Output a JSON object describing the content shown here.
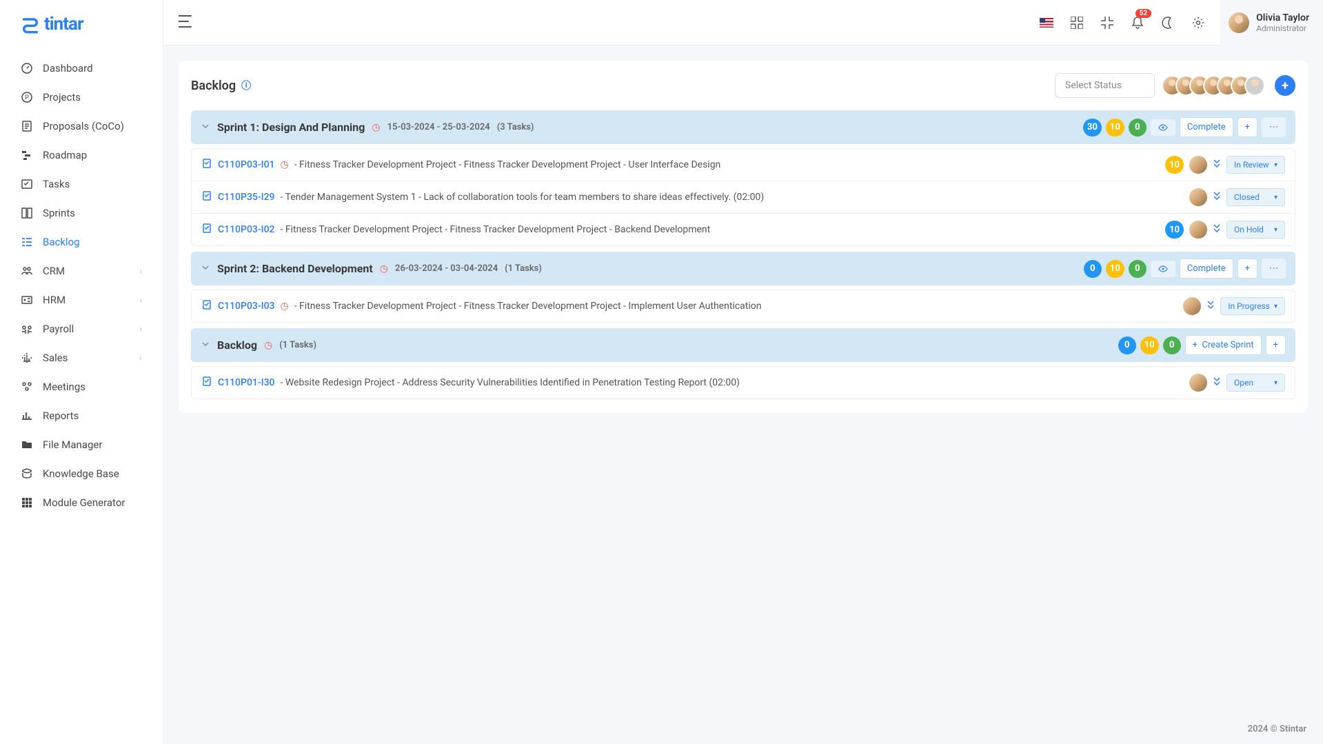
{
  "logo_text": "tintar",
  "user": {
    "name": "Olivia Taylor",
    "role": "Administrator"
  },
  "notif_count": "52",
  "sidebar": [
    {
      "icon": "dashboard",
      "label": "Dashboard",
      "chev": false
    },
    {
      "icon": "projects",
      "label": "Projects",
      "chev": false
    },
    {
      "icon": "proposals",
      "label": "Proposals (CoCo)",
      "chev": false
    },
    {
      "icon": "roadmap",
      "label": "Roadmap",
      "chev": false
    },
    {
      "icon": "tasks",
      "label": "Tasks",
      "chev": false
    },
    {
      "icon": "sprints",
      "label": "Sprints",
      "chev": false
    },
    {
      "icon": "backlog",
      "label": "Backlog",
      "chev": false,
      "active": true
    },
    {
      "icon": "crm",
      "label": "CRM",
      "chev": true
    },
    {
      "icon": "hrm",
      "label": "HRM",
      "chev": true
    },
    {
      "icon": "payroll",
      "label": "Payroll",
      "chev": true
    },
    {
      "icon": "sales",
      "label": "Sales",
      "chev": true
    },
    {
      "icon": "meetings",
      "label": "Meetings",
      "chev": false
    },
    {
      "icon": "reports",
      "label": "Reports",
      "chev": false
    },
    {
      "icon": "filemgr",
      "label": "File Manager",
      "chev": false
    },
    {
      "icon": "kb",
      "label": "Knowledge Base",
      "chev": false
    },
    {
      "icon": "modgen",
      "label": "Module Generator",
      "chev": false
    }
  ],
  "page": {
    "title": "Backlog",
    "select_placeholder": "Select Status"
  },
  "sprints": [
    {
      "title": "Sprint 1: Design And Planning",
      "dates": "15-03-2024 - 25-03-2024",
      "count": "(3 Tasks)",
      "p1": "30",
      "p2": "10",
      "p3": "0",
      "complete_label": "Complete",
      "tasks": [
        {
          "code": "C110P03-I01",
          "clock": true,
          "text": " - Fitness Tracker Development Project - Fitness Tracker Development Project - User Interface Design",
          "pill": "10",
          "pill_color": "yellow",
          "status": "In Review"
        },
        {
          "code": "C110P35-I29",
          "clock": false,
          "text": " - Tender Management System 1 - Lack of collaboration tools for team members to share ideas effectively. (02:00)",
          "pill": "",
          "pill_color": "",
          "status": "Closed"
        },
        {
          "code": "C110P03-I02",
          "clock": false,
          "text": " - Fitness Tracker Development Project - Fitness Tracker Development Project - Backend Development",
          "pill": "10",
          "pill_color": "blue",
          "status": "On Hold"
        }
      ]
    },
    {
      "title": "Sprint 2: Backend Development",
      "dates": "26-03-2024 - 03-04-2024",
      "count": "(1 Tasks)",
      "p1": "0",
      "p2": "10",
      "p3": "0",
      "complete_label": "Complete",
      "tasks": [
        {
          "code": "C110P03-I03",
          "clock": true,
          "text": " - Fitness Tracker Development Project - Fitness Tracker Development Project - Implement User Authentication",
          "pill": "",
          "pill_color": "",
          "status": "In Progress"
        }
      ]
    }
  ],
  "backlog": {
    "title": "Backlog",
    "count": "(1 Tasks)",
    "p1": "0",
    "p2": "10",
    "p3": "0",
    "create_label": "Create Sprint",
    "tasks": [
      {
        "code": "C110P01-I30",
        "clock": false,
        "text": " - Website Redesign Project - Address Security Vulnerabilities Identified in Penetration Testing Report (02:00)",
        "pill": "",
        "pill_color": "",
        "status": "Open"
      }
    ]
  },
  "footer": "2024 © Stintar"
}
